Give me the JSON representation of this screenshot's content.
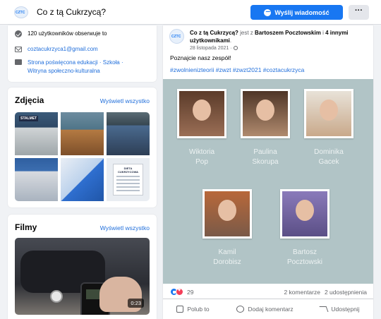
{
  "header": {
    "page_name": "Co z tą Cukrzycą?",
    "logo_text": "CZTC",
    "message_button": "Wyślij wiadomość",
    "more_button": "···"
  },
  "about": {
    "followers": "120 użytkowników obserwuje to",
    "email": "coztacukrzyca1@gmail.com",
    "category_line1": "Strona poświęcona edukacji · Szkoła ·",
    "category_line2": "Witryna społeczno-kulturalna"
  },
  "photos": {
    "title": "Zdjęcia",
    "see_all": "Wyświetl wszystko",
    "sign_text": "STALMET",
    "doc_text": "DIETA CUKRZYCOWA"
  },
  "films": {
    "title": "Filmy",
    "see_all": "Wyświetl wszystko",
    "duration": "0:23"
  },
  "post": {
    "author": "Co z tą Cukrzycą?",
    "with_text": " jest z ",
    "tagged": "Bartoszem Pocztowskim",
    "and_text": " i ",
    "others": "4 innymi użytkownikami",
    "date": "28 listopada 2021 ·",
    "text": "Poznajcie nasz zespół!",
    "hashtags": "#zwolnienizteorii #zwzt #zwzt2021 #coztacukrzyca",
    "members": [
      {
        "first": "Wiktoria",
        "last": "Pop"
      },
      {
        "first": "Paulina",
        "last": "Skorupa"
      },
      {
        "first": "Dominika",
        "last": "Gacek"
      },
      {
        "first": "Kamil",
        "last": "Dorobisz"
      },
      {
        "first": "Bartosz",
        "last": "Pocztowski"
      }
    ],
    "reaction_count": "29",
    "comments": "2 komentarze",
    "shares": "2 udostępnienia",
    "actions": {
      "like": "Polub to",
      "comment": "Dodaj komentarz",
      "share": "Udostępnij"
    }
  },
  "colors": {
    "brand": "#1877f2",
    "banner": "#b1c4c6",
    "link": "#216fdb"
  }
}
